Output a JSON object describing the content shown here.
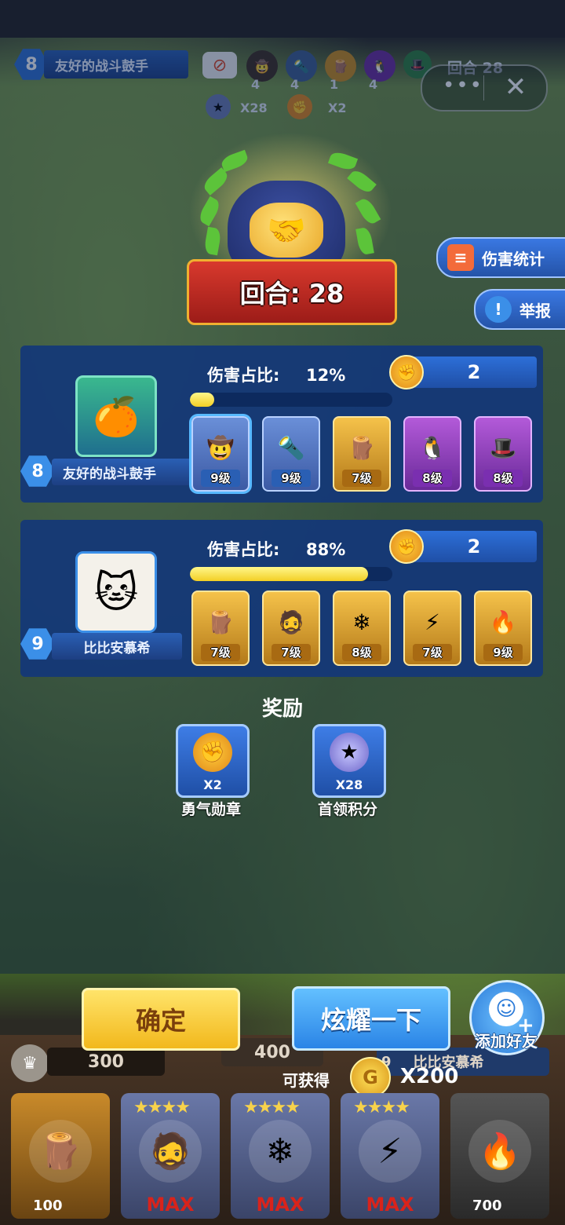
{
  "top_status": {
    "player_level": "8",
    "player_name": "友好的战斗鼓手",
    "hero_counts": [
      "4",
      "4",
      "1",
      "4"
    ],
    "boss_points": "X28",
    "medals": "X2",
    "round_label": "回合 28"
  },
  "mini_program": {
    "more": "•••",
    "close": "✕"
  },
  "round_badge": {
    "text": "回合: 28"
  },
  "side_buttons": {
    "damage_stats": "伤害统计",
    "report": "举报"
  },
  "players": [
    {
      "level": "8",
      "name": "友好的战斗鼓手",
      "damage_label": "伤害占比:",
      "damage_pct_text": "12%",
      "damage_pct": 12,
      "medals": "2",
      "cards": [
        {
          "level": "9级",
          "style": "blue",
          "face": "🤠",
          "selected": true
        },
        {
          "level": "9级",
          "style": "blue",
          "face": "🔦"
        },
        {
          "level": "7级",
          "style": "gold",
          "face": "🪵"
        },
        {
          "level": "8级",
          "style": "purple",
          "face": "🐧"
        },
        {
          "level": "8级",
          "style": "purple",
          "face": "🎩"
        }
      ]
    },
    {
      "level": "9",
      "name": "比比安慕希",
      "damage_label": "伤害占比:",
      "damage_pct_text": "88%",
      "damage_pct": 88,
      "medals": "2",
      "cards": [
        {
          "level": "7级",
          "style": "gold",
          "face": "🪵"
        },
        {
          "level": "7级",
          "style": "gold",
          "face": "🧔"
        },
        {
          "level": "8级",
          "style": "gold",
          "face": "❄"
        },
        {
          "level": "7级",
          "style": "gold",
          "face": "⚡"
        },
        {
          "level": "9级",
          "style": "gold",
          "face": "🔥"
        }
      ]
    }
  ],
  "rewards": {
    "title": "奖励",
    "items": [
      {
        "count": "X2",
        "label": "勇气勋章"
      },
      {
        "count": "X28",
        "label": "首领积分"
      }
    ]
  },
  "buttons": {
    "confirm": "确定",
    "show_off": "炫耀一下",
    "add_friend": "添加好友"
  },
  "bottom": {
    "coins_left": "300",
    "coins_mid": "400",
    "right_player_level": "9",
    "right_player_name": "比比安慕希",
    "obtainable_label": "可获得",
    "obtainable_amount": "X200",
    "hero_slots": [
      {
        "bottom_text": "100",
        "type": "cost"
      },
      {
        "bottom_text": "MAX",
        "type": "max"
      },
      {
        "bottom_text": "MAX",
        "type": "max"
      },
      {
        "bottom_text": "MAX",
        "type": "max"
      },
      {
        "bottom_text": "700",
        "type": "cost"
      }
    ]
  },
  "colors": {
    "accent_blue": "#2a84e6",
    "accent_gold": "#f2b81c",
    "max_red": "#d9231b"
  }
}
